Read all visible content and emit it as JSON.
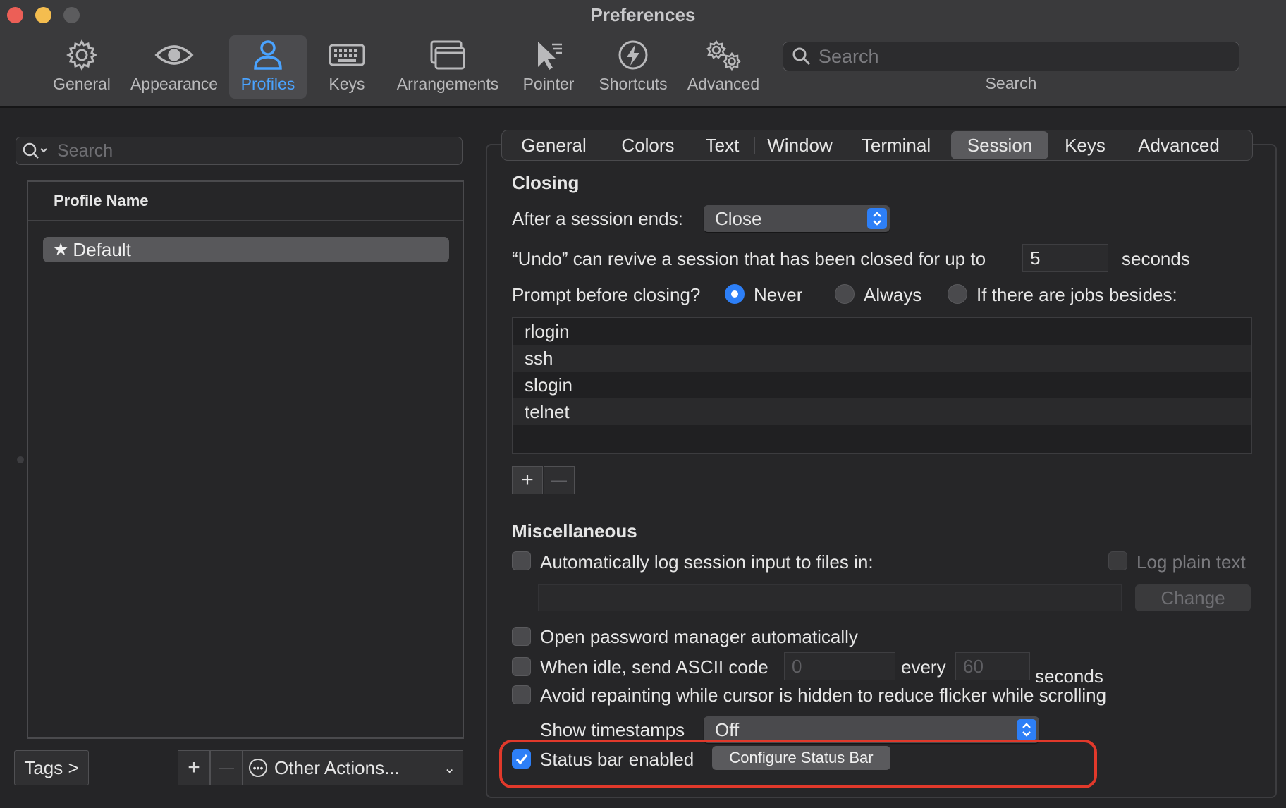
{
  "window": {
    "title": "Preferences"
  },
  "toolbar": {
    "items": [
      {
        "label": "General",
        "icon": "gear-icon"
      },
      {
        "label": "Appearance",
        "icon": "eye-icon"
      },
      {
        "label": "Profiles",
        "icon": "person-icon",
        "active": true
      },
      {
        "label": "Keys",
        "icon": "keyboard-icon"
      },
      {
        "label": "Arrangements",
        "icon": "windows-icon"
      },
      {
        "label": "Pointer",
        "icon": "pointer-icon"
      },
      {
        "label": "Shortcuts",
        "icon": "bolt-icon"
      },
      {
        "label": "Advanced",
        "icon": "gears-icon"
      }
    ],
    "search_placeholder": "Search",
    "search_caption": "Search"
  },
  "profiles": {
    "search_placeholder": "Search",
    "column_header": "Profile Name",
    "rows": [
      {
        "name": "Default",
        "default": true
      }
    ],
    "tags_button": "Tags >",
    "add_symbol": "+",
    "remove_symbol": "—",
    "other_actions": "Other Actions..."
  },
  "tabs": [
    "General",
    "Colors",
    "Text",
    "Window",
    "Terminal",
    "Session",
    "Keys",
    "Advanced"
  ],
  "active_tab": "Session",
  "closing": {
    "title": "Closing",
    "after_session_label": "After a session ends:",
    "after_session_value": "Close",
    "undo_label": "“Undo” can revive a session that has been closed for up to",
    "undo_value": "5",
    "undo_unit": "seconds",
    "prompt_label": "Prompt before closing?",
    "prompt_options": [
      "Never",
      "Always",
      "If there are jobs besides:"
    ],
    "prompt_selected": "Never",
    "jobs": [
      "rlogin",
      "ssh",
      "slogin",
      "telnet"
    ],
    "add_symbol": "+",
    "remove_symbol": "—"
  },
  "misc": {
    "title": "Miscellaneous",
    "auto_log_label": "Automatically log session input to files in:",
    "log_plain_label": "Log plain text",
    "change_button": "Change",
    "password_manager_label": "Open password manager automatically",
    "idle_label": "When idle, send ASCII code",
    "idle_code": "0",
    "idle_every": "every",
    "idle_interval": "60",
    "idle_unit": "seconds",
    "avoid_repaint_label": "Avoid repainting while cursor is hidden to reduce flicker while scrolling",
    "timestamps_label": "Show timestamps",
    "timestamps_value": "Off",
    "status_bar_label": "Status bar enabled",
    "status_bar_checked": true,
    "configure_button": "Configure Status Bar"
  },
  "colors": {
    "accent": "#2d7ff7",
    "active_toolbar": "#4aa3ff",
    "highlight": "#e1392b"
  }
}
